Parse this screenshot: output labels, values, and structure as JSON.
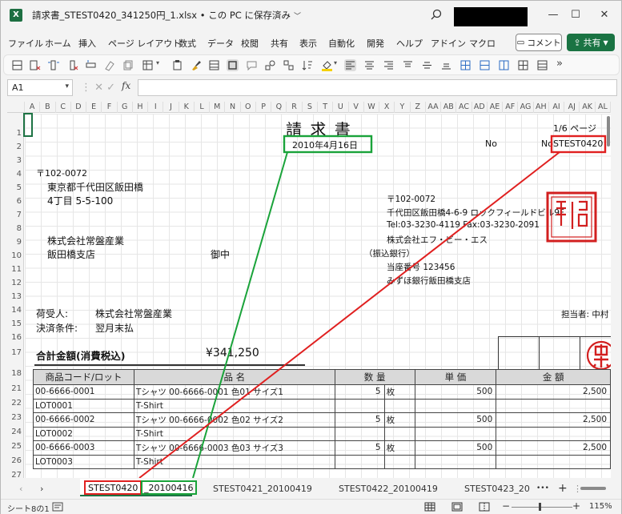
{
  "window": {
    "title": "請求書_STEST0420_341250円_1.xlsx • この PC に保存済み",
    "logo_letter": "X"
  },
  "menu": [
    "ファイル",
    "ホーム",
    "挿入",
    "ページ レイアウト",
    "数式",
    "データ",
    "校閲",
    "共有",
    "表示",
    "自動化",
    "開発",
    "ヘルプ",
    "アドイン",
    "マクロ"
  ],
  "buttons": {
    "comment": "コメント",
    "share": "共有"
  },
  "formula_bar": {
    "name_box": "A1",
    "fx": "fx",
    "value": ""
  },
  "columns": [
    "A",
    "B",
    "C",
    "D",
    "E",
    "F",
    "G",
    "H",
    "I",
    "J",
    "K",
    "L",
    "M",
    "N",
    "O",
    "P",
    "Q",
    "R",
    "S",
    "T",
    "U",
    "V",
    "W",
    "X",
    "Y",
    "Z",
    "AA",
    "AB",
    "AC",
    "AD",
    "AE",
    "AF",
    "AG",
    "AH",
    "AI",
    "AJ",
    "AK",
    "AL"
  ],
  "rows": [
    "1",
    "2",
    "3",
    "4",
    "5",
    "6",
    "7",
    "8",
    "9",
    "10",
    "11",
    "12",
    "13",
    "14",
    "15",
    "16",
    "17",
    "18",
    "21",
    "22",
    "23",
    "24",
    "25",
    "26",
    "27"
  ],
  "invoice": {
    "title": "請 求 書",
    "page": "1/6 ページ",
    "date": "2010年4月16日",
    "no_label": "No",
    "no_label2": "No",
    "invoice_no": "STEST0420",
    "postal": "〒102-0072",
    "address1": "東京都千代田区飯田橋",
    "address2": "4丁目 5-5-100",
    "company": "株式会社常盤産業",
    "branch": "飯田橋支店",
    "honorific": "御中",
    "sender_postal": "〒102-0072",
    "sender_address": "千代田区飯田橋4-6-9 ロックフィールドビル9F",
    "sender_tel": "Tel:03-3230-4119  Fax:03-3230-2091",
    "sender_company": "株式会社エフ・ビー・エス",
    "bank_label": "（振込銀行）",
    "account_no": "当座番号 123456",
    "bank_name": "みずほ銀行飯田橋支店",
    "recipient_label": "荷受人:",
    "recipient": "株式会社常盤産業",
    "staff": "担当者: 中村",
    "terms_label": "決済条件:",
    "terms": "翌月末払",
    "total_label": "合計金額(消費税込)",
    "total": "¥341,250",
    "stamp_company": "株式会社",
    "stamp_person": "中村"
  },
  "table": {
    "headers": [
      "商品コード/ロット",
      "品 名",
      "数 量",
      "単 価",
      "金 額"
    ],
    "rows": [
      {
        "code": "00-6666-0001",
        "name": "Tシャツ 00-6666-0001 色01 サイズ1",
        "qty": "5",
        "unit": "枚",
        "price": "500",
        "amount": "2,500"
      },
      {
        "code": "LOT0001",
        "name": "T-Shirt",
        "qty": "",
        "unit": "",
        "price": "",
        "amount": ""
      },
      {
        "code": "00-6666-0002",
        "name": "Tシャツ 00-6666-0002 色02 サイズ2",
        "qty": "5",
        "unit": "枚",
        "price": "500",
        "amount": "2,500"
      },
      {
        "code": "LOT0002",
        "name": "T-Shirt",
        "qty": "",
        "unit": "",
        "price": "",
        "amount": ""
      },
      {
        "code": "00-6666-0003",
        "name": "Tシャツ 00-6666-0003 色03 サイズ3",
        "qty": "5",
        "unit": "枚",
        "price": "500",
        "amount": "2,500"
      },
      {
        "code": "LOT0003",
        "name": "T-Shirt",
        "qty": "",
        "unit": "",
        "price": "",
        "amount": ""
      }
    ]
  },
  "tabs": {
    "active_part1": "STEST0420",
    "active_part2": "_20100416",
    "others": [
      "STEST0421_20100419",
      "STEST0422_20100419",
      "STEST0423_20"
    ],
    "more": "•••",
    "add": "+"
  },
  "status": {
    "sheet_info": "シート8の1",
    "zoom": "115%"
  },
  "colors": {
    "excel_green": "#1d7344",
    "highlight_red": "#e02020",
    "highlight_green": "#1aa33a",
    "header_gray": "#d9d9d9"
  }
}
